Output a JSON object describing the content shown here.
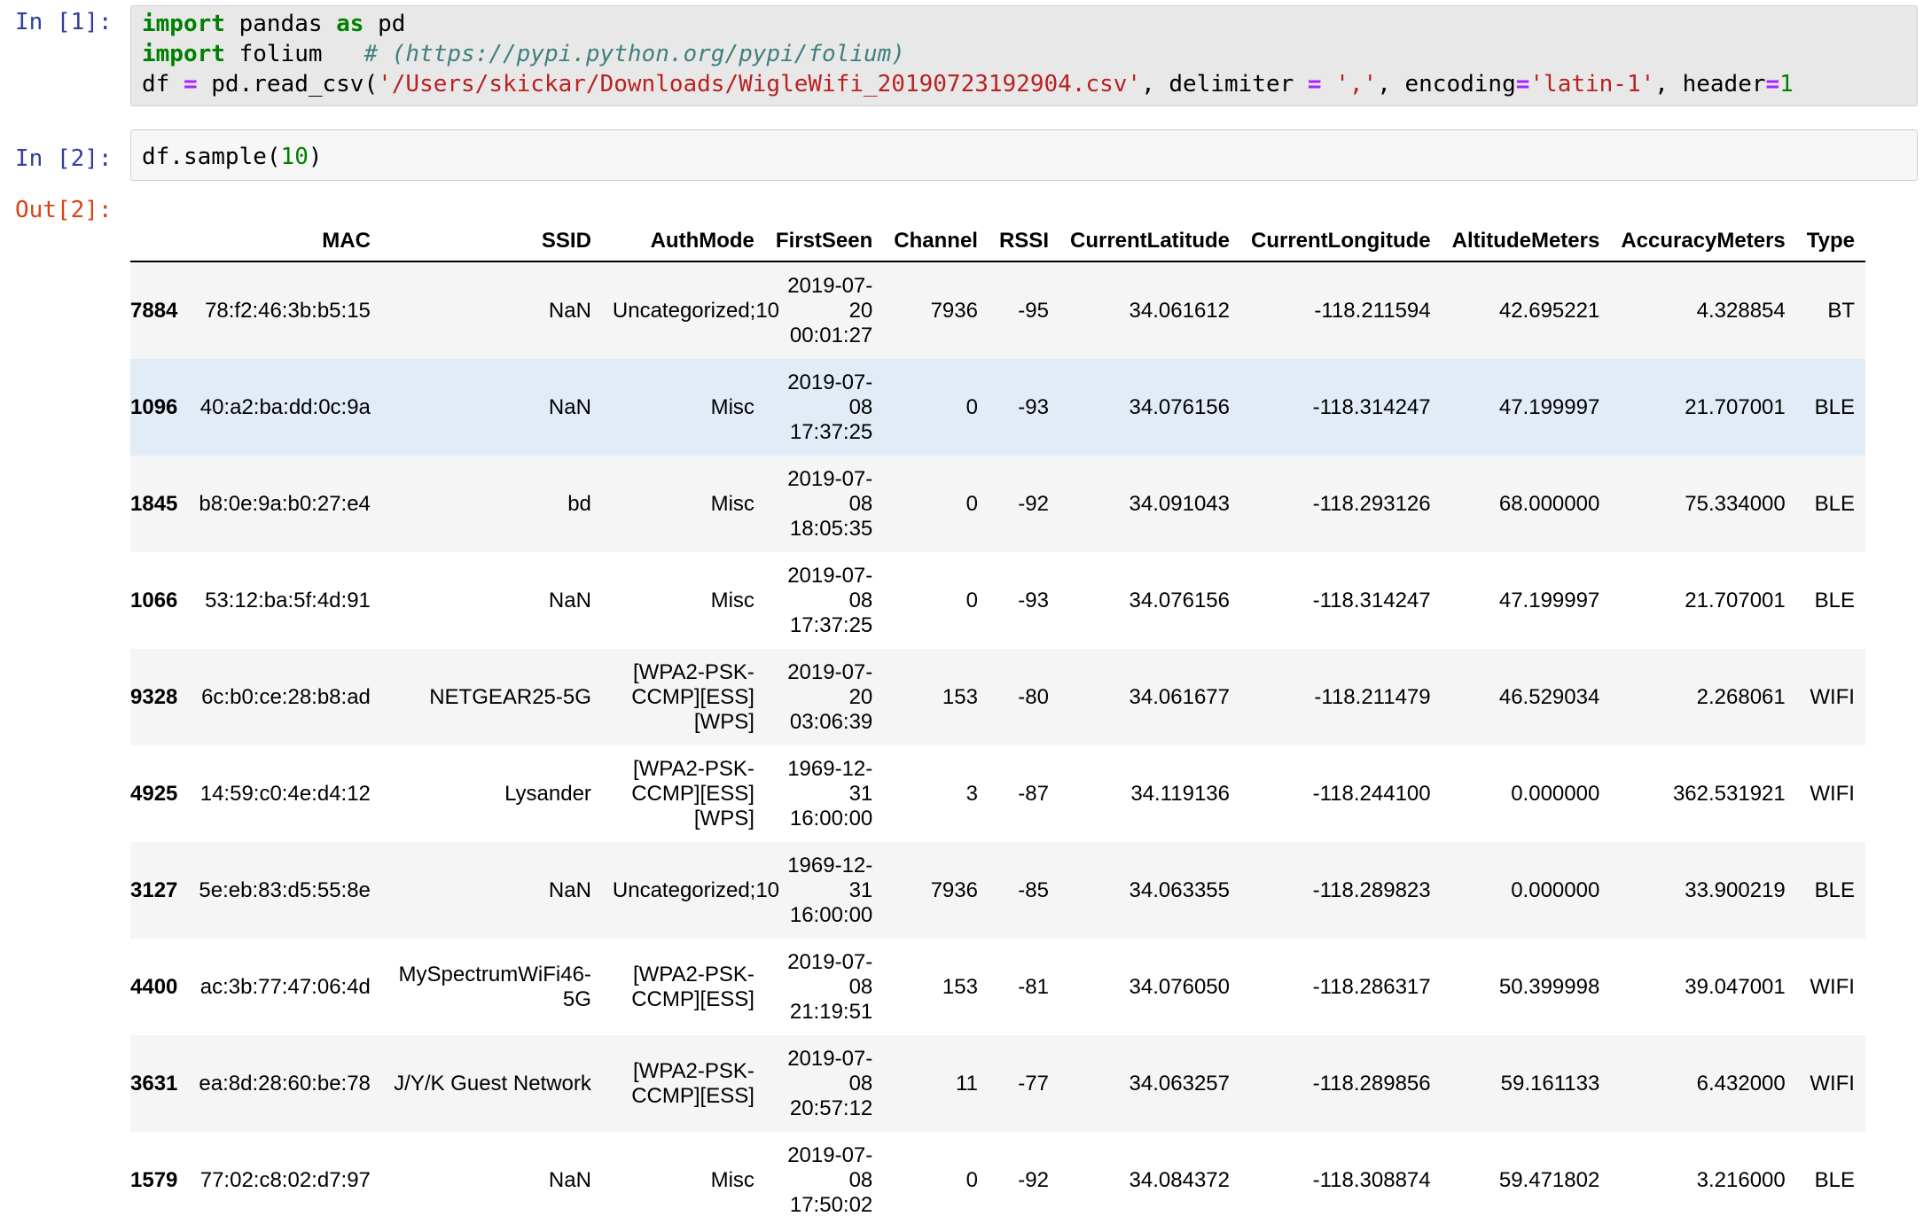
{
  "cells": [
    {
      "prompt": "In [1]:",
      "lines": [
        [
          {
            "t": "import",
            "c": "kw"
          },
          {
            "t": " pandas ",
            "c": ""
          },
          {
            "t": "as",
            "c": "kw"
          },
          {
            "t": " pd",
            "c": ""
          }
        ],
        [
          {
            "t": "import",
            "c": "kw"
          },
          {
            "t": " folium   ",
            "c": ""
          },
          {
            "t": "# (https://pypi.python.org/pypi/folium)",
            "c": "cm"
          }
        ],
        [
          {
            "t": "df ",
            "c": ""
          },
          {
            "t": "=",
            "c": "op"
          },
          {
            "t": " pd.read_csv(",
            "c": ""
          },
          {
            "t": "'/Users/skickar/Downloads/WigleWifi_20190723192904.csv'",
            "c": "str"
          },
          {
            "t": ", delimiter ",
            "c": ""
          },
          {
            "t": "=",
            "c": "op"
          },
          {
            "t": " ",
            "c": ""
          },
          {
            "t": "','",
            "c": "str"
          },
          {
            "t": ", encoding",
            "c": ""
          },
          {
            "t": "=",
            "c": "op"
          },
          {
            "t": "'latin-1'",
            "c": "str"
          },
          {
            "t": ", header",
            "c": ""
          },
          {
            "t": "=",
            "c": "op"
          },
          {
            "t": "1",
            "c": "num"
          }
        ]
      ]
    },
    {
      "prompt": "In [2]:",
      "lines": [
        [
          {
            "t": "df.sample(",
            "c": ""
          },
          {
            "t": "10",
            "c": "num"
          },
          {
            "t": ")",
            "c": ""
          }
        ]
      ]
    }
  ],
  "output": {
    "prompt": "Out[2]:",
    "columns": [
      "",
      "MAC",
      "SSID",
      "AuthMode",
      "FirstSeen",
      "Channel",
      "RSSI",
      "CurrentLatitude",
      "CurrentLongitude",
      "AltitudeMeters",
      "AccuracyMeters",
      "Type"
    ],
    "hover_row": 1,
    "rows": [
      {
        "index": "7884",
        "MAC": "78:f2:46:3b:b5:15",
        "SSID": "NaN",
        "AuthMode": "Uncategorized;10",
        "FirstSeen": "2019-07-20 00:01:27",
        "Channel": "7936",
        "RSSI": "-95",
        "CurrentLatitude": "34.061612",
        "CurrentLongitude": "-118.211594",
        "AltitudeMeters": "42.695221",
        "AccuracyMeters": "4.328854",
        "Type": "BT"
      },
      {
        "index": "1096",
        "MAC": "40:a2:ba:dd:0c:9a",
        "SSID": "NaN",
        "AuthMode": "Misc",
        "FirstSeen": "2019-07-08 17:37:25",
        "Channel": "0",
        "RSSI": "-93",
        "CurrentLatitude": "34.076156",
        "CurrentLongitude": "-118.314247",
        "AltitudeMeters": "47.199997",
        "AccuracyMeters": "21.707001",
        "Type": "BLE"
      },
      {
        "index": "1845",
        "MAC": "b8:0e:9a:b0:27:e4",
        "SSID": "bd",
        "AuthMode": "Misc",
        "FirstSeen": "2019-07-08 18:05:35",
        "Channel": "0",
        "RSSI": "-92",
        "CurrentLatitude": "34.091043",
        "CurrentLongitude": "-118.293126",
        "AltitudeMeters": "68.000000",
        "AccuracyMeters": "75.334000",
        "Type": "BLE"
      },
      {
        "index": "1066",
        "MAC": "53:12:ba:5f:4d:91",
        "SSID": "NaN",
        "AuthMode": "Misc",
        "FirstSeen": "2019-07-08 17:37:25",
        "Channel": "0",
        "RSSI": "-93",
        "CurrentLatitude": "34.076156",
        "CurrentLongitude": "-118.314247",
        "AltitudeMeters": "47.199997",
        "AccuracyMeters": "21.707001",
        "Type": "BLE"
      },
      {
        "index": "9328",
        "MAC": "6c:b0:ce:28:b8:ad",
        "SSID": "NETGEAR25-5G",
        "AuthMode": "[WPA2-PSK-CCMP][ESS][WPS]",
        "FirstSeen": "2019-07-20 03:06:39",
        "Channel": "153",
        "RSSI": "-80",
        "CurrentLatitude": "34.061677",
        "CurrentLongitude": "-118.211479",
        "AltitudeMeters": "46.529034",
        "AccuracyMeters": "2.268061",
        "Type": "WIFI"
      },
      {
        "index": "4925",
        "MAC": "14:59:c0:4e:d4:12",
        "SSID": "Lysander",
        "AuthMode": "[WPA2-PSK-CCMP][ESS][WPS]",
        "FirstSeen": "1969-12-31 16:00:00",
        "Channel": "3",
        "RSSI": "-87",
        "CurrentLatitude": "34.119136",
        "CurrentLongitude": "-118.244100",
        "AltitudeMeters": "0.000000",
        "AccuracyMeters": "362.531921",
        "Type": "WIFI"
      },
      {
        "index": "3127",
        "MAC": "5e:eb:83:d5:55:8e",
        "SSID": "NaN",
        "AuthMode": "Uncategorized;10",
        "FirstSeen": "1969-12-31 16:00:00",
        "Channel": "7936",
        "RSSI": "-85",
        "CurrentLatitude": "34.063355",
        "CurrentLongitude": "-118.289823",
        "AltitudeMeters": "0.000000",
        "AccuracyMeters": "33.900219",
        "Type": "BLE"
      },
      {
        "index": "4400",
        "MAC": "ac:3b:77:47:06:4d",
        "SSID": "MySpectrumWiFi46-5G",
        "AuthMode": "[WPA2-PSK-CCMP][ESS]",
        "FirstSeen": "2019-07-08 21:19:51",
        "Channel": "153",
        "RSSI": "-81",
        "CurrentLatitude": "34.076050",
        "CurrentLongitude": "-118.286317",
        "AltitudeMeters": "50.399998",
        "AccuracyMeters": "39.047001",
        "Type": "WIFI"
      },
      {
        "index": "3631",
        "MAC": "ea:8d:28:60:be:78",
        "SSID": "J/Y/K Guest Network",
        "AuthMode": "[WPA2-PSK-CCMP][ESS]",
        "FirstSeen": "2019-07-08 20:57:12",
        "Channel": "11",
        "RSSI": "-77",
        "CurrentLatitude": "34.063257",
        "CurrentLongitude": "-118.289856",
        "AltitudeMeters": "59.161133",
        "AccuracyMeters": "6.432000",
        "Type": "WIFI"
      },
      {
        "index": "1579",
        "MAC": "77:02:c8:02:d7:97",
        "SSID": "NaN",
        "AuthMode": "Misc",
        "FirstSeen": "2019-07-08 17:50:02",
        "Channel": "0",
        "RSSI": "-92",
        "CurrentLatitude": "34.084372",
        "CurrentLongitude": "-118.308874",
        "AltitudeMeters": "59.471802",
        "AccuracyMeters": "3.216000",
        "Type": "BLE"
      }
    ]
  }
}
